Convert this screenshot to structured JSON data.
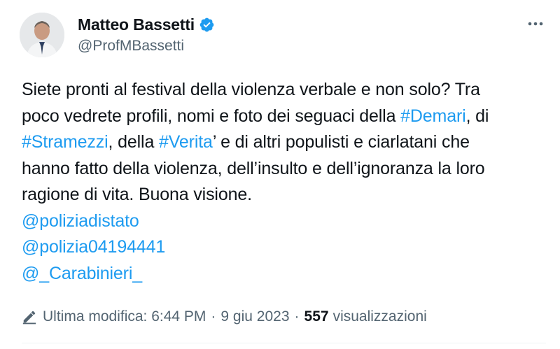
{
  "author": {
    "name": "Matteo Bassetti",
    "handle": "@ProfMBassetti",
    "verified_color": "#1d9bf0"
  },
  "tweet": {
    "lines": [
      [
        {
          "t": "Siete pronti al festival della violenza verbale e non solo? Tra"
        }
      ],
      [
        {
          "t": "poco vedrete profili, nomi e foto dei seguaci della "
        },
        {
          "t": "#Demari",
          "link": true
        },
        {
          "t": ", di"
        }
      ],
      [
        {
          "t": "#Stramezzi",
          "link": true
        },
        {
          "t": ", della "
        },
        {
          "t": "#Verita",
          "link": true
        },
        {
          "t": "’ e di altri populisti e ciarlatani che"
        }
      ],
      [
        {
          "t": "hanno fatto della violenza, dell’insulto e dell’ignoranza la loro"
        }
      ],
      [
        {
          "t": "ragione di vita. Buona visione."
        }
      ],
      [
        {
          "t": "@poliziadistato",
          "link": true
        }
      ],
      [
        {
          "t": "@polizia04194441",
          "link": true
        }
      ],
      [
        {
          "t": "@_Carabinieri_",
          "link": true
        }
      ]
    ]
  },
  "meta": {
    "edited_label": "Ultima modifica: 6:44 PM",
    "separator": "·",
    "date": "9 giu 2023",
    "views_count": "557",
    "views_label": "visualizzazioni"
  },
  "icons": {
    "more": "more-icon",
    "edit": "pencil-icon",
    "verified": "verified-badge-icon"
  },
  "colors": {
    "link": "#1d9bf0",
    "secondary_text": "#536471",
    "primary_text": "#0f1419"
  }
}
